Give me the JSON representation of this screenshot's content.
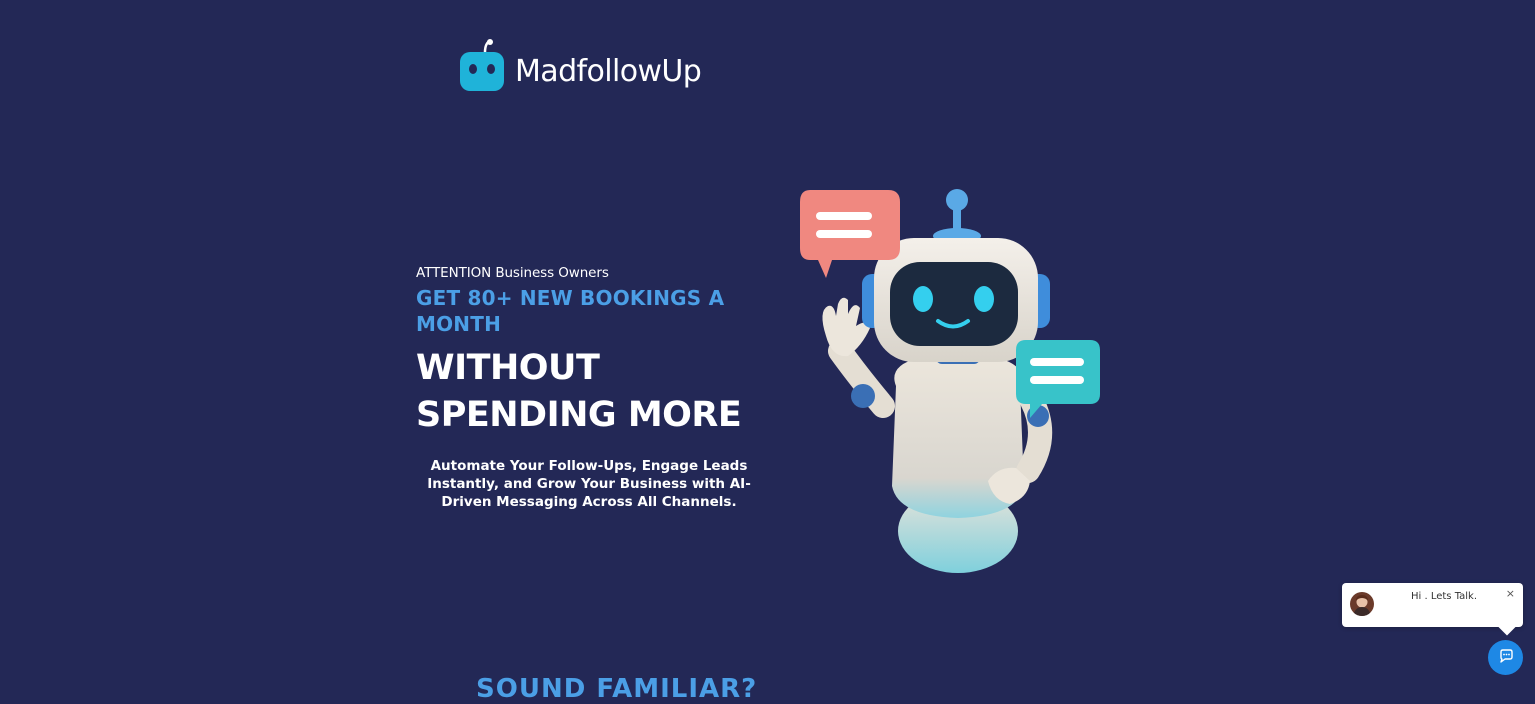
{
  "brand": {
    "name": "MadfollowUp",
    "icon": "robot-head-icon",
    "color": "#1fb3d9"
  },
  "hero": {
    "attention": "ATTENTION Business Owners",
    "headline_blue": "GET 80+ NEW BOOKINGS A MONTH",
    "headline_white": "WITHOUT SPENDING MORE",
    "subtext": "Automate Your Follow-Ups, Engage Leads Instantly, and Grow Your Business with AI-Driven Messaging Across All Channels."
  },
  "illustration": {
    "icon": "waving-robot-illustration",
    "bubble_left_color": "#f08880",
    "bubble_right_color": "#38c3c9"
  },
  "next_section": {
    "heading": "SOUND FAMILIAR?"
  },
  "chat_widget": {
    "message": "Hi . Lets Talk.",
    "close_label": "×",
    "launcher_icon": "chat-icon",
    "accent": "#1e88e5"
  },
  "colors": {
    "background": "#232856",
    "accent_blue": "#4b9fe6"
  }
}
